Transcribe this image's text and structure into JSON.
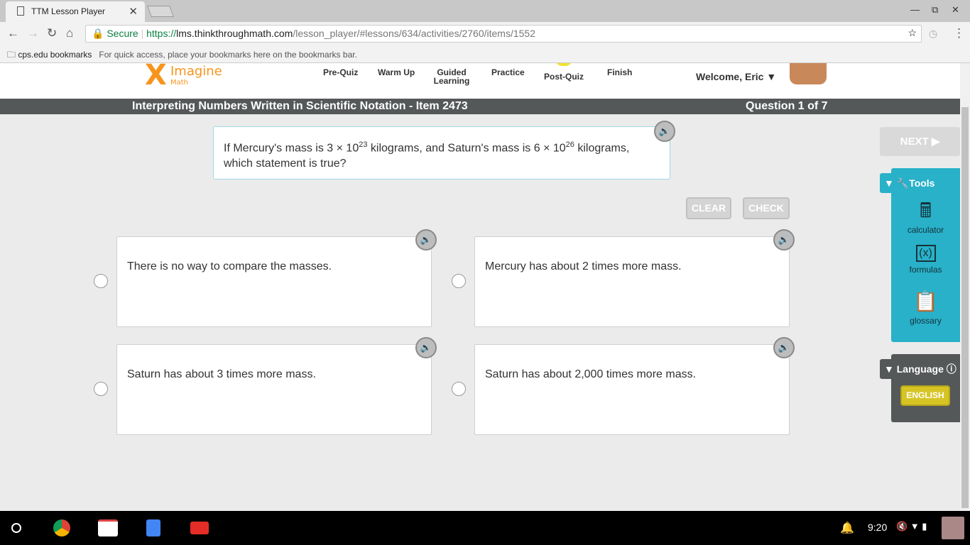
{
  "browser": {
    "tab_title": "TTM Lesson Player",
    "secure_label": "Secure",
    "url_scheme": "https://",
    "url_host": "lms.thinkthroughmath.com",
    "url_path": "/lesson_player/#lessons/634/activities/2760/items/1552",
    "bookmarks_folder": "cps.edu bookmarks",
    "bookmarks_hint": "For quick access, place your bookmarks here on the bookmarks bar."
  },
  "header": {
    "logo_top": "Imagine",
    "logo_bottom": "Math",
    "menu": [
      "Pre-Quiz",
      "Warm Up",
      "Guided Learning",
      "Practice",
      "Post-Quiz",
      "Finish"
    ],
    "welcome": "Welcome, Eric ▼"
  },
  "titlebar": {
    "title": "Interpreting Numbers Written in Scientific Notation - Item 2473",
    "progress": "Question 1 of 7"
  },
  "question": {
    "p1": "If Mercury's mass is 3 × 10",
    "e1": "23",
    "p2": " kilograms, and Saturn's mass is 6 × 10",
    "e2": "26",
    "p3": " kilograms, which statement is true?"
  },
  "buttons": {
    "clear": "CLEAR",
    "check": "CHECK",
    "next": "NEXT ▶"
  },
  "answers": [
    "There is no way to compare the masses.",
    "Mercury has about 2 times more mass.",
    "Saturn has about 3 times more mass.",
    "Saturn has about 2,000 times more mass."
  ],
  "tools": {
    "header": "▼ 🔧Tools",
    "items": [
      "calculator",
      "formulas",
      "glossary"
    ]
  },
  "language": {
    "header": "▼ Language ⓘ",
    "value": "ENGLISH"
  },
  "shelf": {
    "time": "9:20"
  }
}
